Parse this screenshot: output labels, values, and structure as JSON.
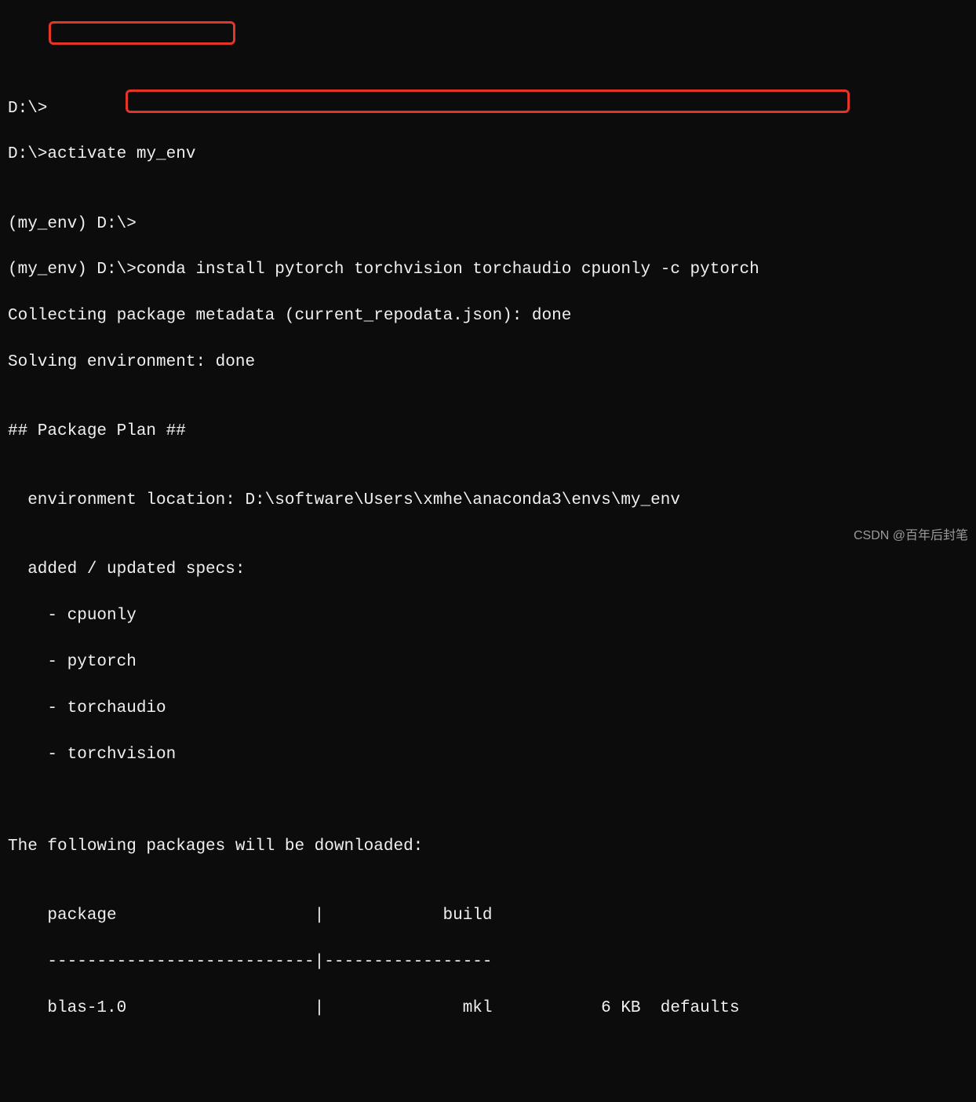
{
  "lines": {
    "l1_prompt": "D:\\>",
    "l2_prompt": "D:\\>",
    "l2_cmd": "activate my_env",
    "l3": "",
    "l4_prompt": "(my_env) D:\\>",
    "l5_prompt": "(my_env) D:\\>",
    "l5_cmd": "conda install pytorch torchvision torchaudio cpuonly -c pytorch",
    "l6": "Collecting package metadata (current_repodata.json): done",
    "l7": "Solving environment: done",
    "l8": "",
    "l9": "## Package Plan ##",
    "l10": "",
    "l11": "  environment location: D:\\software\\Users\\xmhe\\anaconda3\\envs\\my_env",
    "l12": "",
    "l13": "  added / updated specs:",
    "l14": "    - cpuonly",
    "l15": "    - pytorch",
    "l16": "    - torchaudio",
    "l17": "    - torchvision",
    "l18": "",
    "l19": "",
    "l20": "The following packages will be downloaded:",
    "l21": "",
    "l22": "    package                    |            build",
    "l23": "    ---------------------------|-----------------",
    "l24": "    blas-1.0                   |              mkl           6 KB  defaults"
  },
  "watermark": "CSDN @百年后封笔"
}
